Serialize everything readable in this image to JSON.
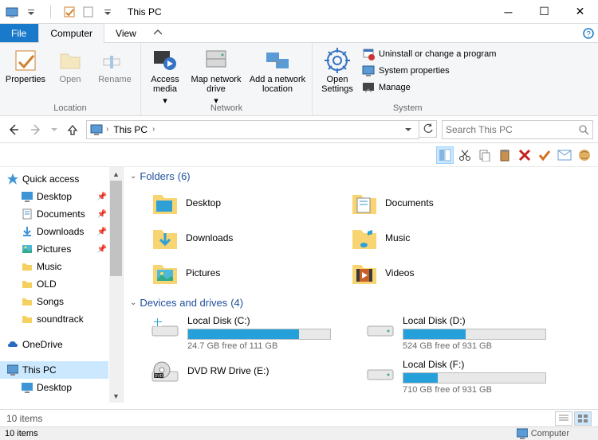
{
  "title": "This PC",
  "tabs": {
    "file": "File",
    "computer": "Computer",
    "view": "View"
  },
  "ribbon": {
    "location": {
      "label": "Location",
      "properties": "Properties",
      "open": "Open",
      "rename": "Rename"
    },
    "network": {
      "label": "Network",
      "access": "Access media",
      "mapdrive": "Map network drive",
      "addloc": "Add a network location"
    },
    "system": {
      "label": "System",
      "opensettings": "Open Settings",
      "uninstall": "Uninstall or change a program",
      "sysprops": "System properties",
      "manage": "Manage"
    }
  },
  "breadcrumb": {
    "root": "This PC"
  },
  "search": {
    "placeholder": "Search This PC"
  },
  "nav": {
    "quick": "Quick access",
    "desktop": "Desktop",
    "documents": "Documents",
    "downloads": "Downloads",
    "pictures": "Pictures",
    "music": "Music",
    "old": "OLD",
    "songs": "Songs",
    "soundtrack": "soundtrack",
    "onedrive": "OneDrive",
    "thispc": "This PC",
    "pc_desktop": "Desktop"
  },
  "sections": {
    "folders": {
      "title": "Folders",
      "count": "(6)"
    },
    "drives": {
      "title": "Devices and drives",
      "count": "(4)"
    }
  },
  "folders": {
    "desktop": "Desktop",
    "documents": "Documents",
    "downloads": "Downloads",
    "music": "Music",
    "pictures": "Pictures",
    "videos": "Videos"
  },
  "drives": {
    "c": {
      "name": "Local Disk (C:)",
      "free": "24.7 GB free of 111 GB",
      "pct": 78
    },
    "d": {
      "name": "Local Disk (D:)",
      "free": "524 GB free of 931 GB",
      "pct": 44
    },
    "e": {
      "name": "DVD RW Drive (E:)"
    },
    "f": {
      "name": "Local Disk (F:)",
      "free": "710 GB free of 931 GB",
      "pct": 24
    }
  },
  "status": {
    "items": "10 items",
    "bottom": "10 items",
    "computer": "Computer"
  }
}
